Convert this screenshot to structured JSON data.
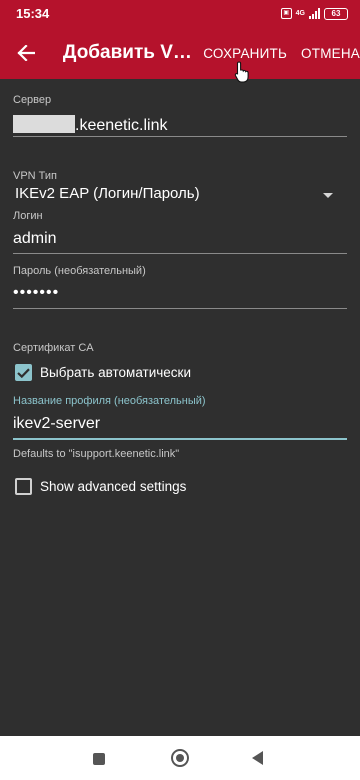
{
  "status_bar": {
    "time": "15:34",
    "network_type": "4G",
    "battery_level": "63"
  },
  "app_bar": {
    "title": "Добавить VP...",
    "save_label": "СОХРАНИТЬ",
    "cancel_label": "ОТМЕНА"
  },
  "form": {
    "server_label": "Сервер",
    "server_value_suffix": ".keenetic.link",
    "vpn_type_label": "VPN Тип",
    "vpn_type_value": "IKEv2 EAP (Логин/Пароль)",
    "login_label": "Логин",
    "login_value": "admin",
    "password_label": "Пароль (необязательный)",
    "password_value": "•••••••",
    "ca_cert_label": "Сертификат CA",
    "auto_select_label": "Выбрать автоматически",
    "auto_select_checked": true,
    "profile_name_label": "Название профиля (необязательный)",
    "profile_name_value": "ikev2-server",
    "profile_name_helper": "Defaults to \"isupport.keenetic.link\"",
    "advanced_label": "Show advanced settings",
    "advanced_checked": false
  },
  "colors": {
    "primary": "#b5122c",
    "accent": "#8cc4cc",
    "background": "#2f2f2f"
  },
  "icons": {
    "back": "arrow-left-icon",
    "dropdown": "caret-down-icon",
    "cursor": "hand-pointer-icon"
  }
}
